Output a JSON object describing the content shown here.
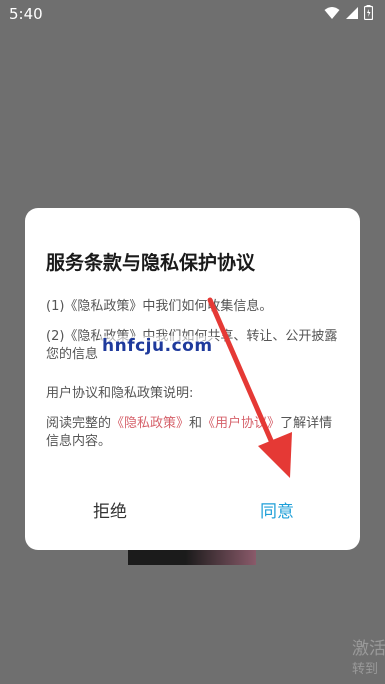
{
  "status_bar": {
    "time": "5:40",
    "icons": [
      "wifi-icon",
      "signal-icon",
      "battery-icon"
    ]
  },
  "dialog": {
    "title": "服务条款与隐私保护协议",
    "item1": "(1)《隐私政策》中我们如何收集信息。",
    "item2": "(2)《隐私政策》中我们如何共享、转让、公开披露您的信息",
    "section_heading": "用户协议和隐私政策说明:",
    "body_prefix": "阅读完整的",
    "privacy_link": "《隐私政策》",
    "and_text": "和",
    "user_agreement_link": "《用户协议》",
    "body_suffix": "了解详情信息内容。",
    "decline_label": "拒绝",
    "agree_label": "同意"
  },
  "overlay": {
    "site_watermark": "hnfcju.com",
    "bg_watermark_line1": "激活",
    "bg_watermark_line2": "转到"
  },
  "colors": {
    "link": "#d6626b",
    "agree": "#1e9fd8",
    "arrow": "#e53935",
    "backdrop": "#6f6f6f"
  }
}
